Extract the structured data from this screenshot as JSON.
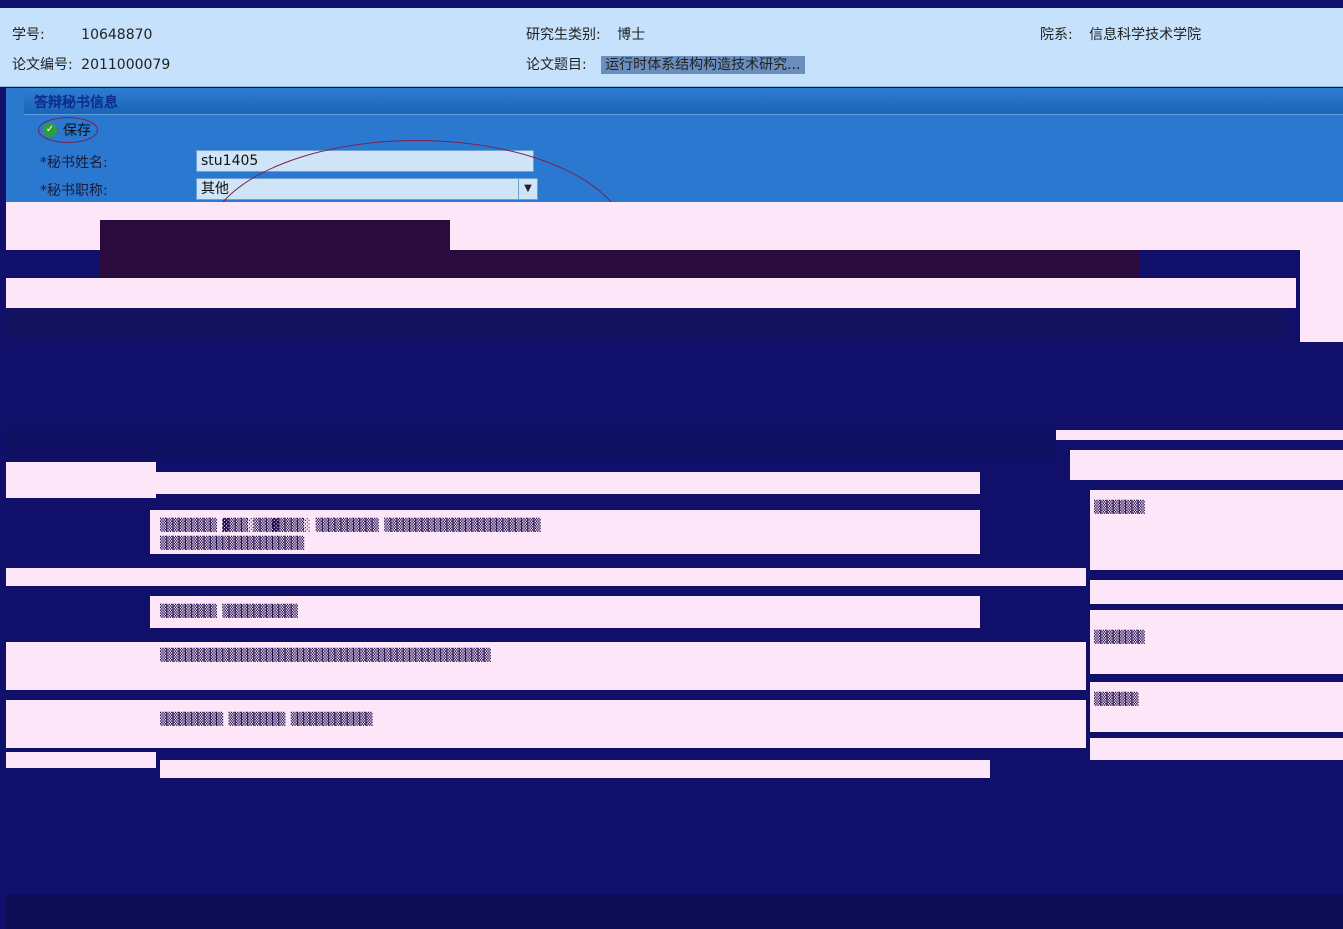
{
  "info": {
    "student_id_label": "学号:",
    "student_id_value": "10648870",
    "category_label": "研究生类别:",
    "category_value": "博士",
    "dept_label": "院系:",
    "dept_value": "信息科学技术学院",
    "thesis_no_label": "论文编号:",
    "thesis_no_value": "2011000079",
    "thesis_title_label": "论文题目:",
    "thesis_title_value": "运行时体系结构构造技术研究..."
  },
  "panel": {
    "title": "答辩秘书信息",
    "save_label": "保存",
    "name_label": "*秘书姓名:",
    "name_value": "stu1405",
    "rank_label": "*秘书职称:",
    "rank_value": "其他"
  },
  "colors": {
    "info_bg": "#c5e1fb",
    "panel_header": "#1b63b6",
    "corruption_bg": "#10106a",
    "corruption_light": "#fde6f7"
  },
  "icons": [
    "check-circle-icon",
    "chevron-down-icon"
  ]
}
